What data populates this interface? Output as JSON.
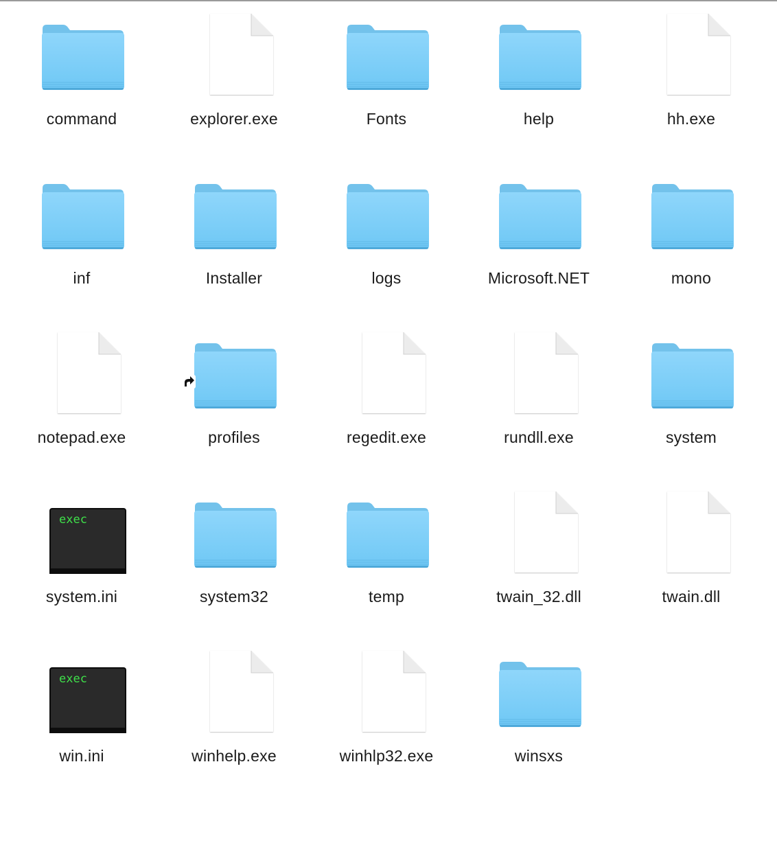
{
  "colors": {
    "folder_light": "#8fd6fb",
    "folder_main": "#6fc8f5",
    "folder_edge": "#5ab7e8",
    "terminal_bg": "#2a2a2a",
    "terminal_text": "#3fe04a",
    "label_text": "#1b1b1b"
  },
  "files": [
    {
      "name": "command",
      "icon": "folder-icon"
    },
    {
      "name": "explorer.exe",
      "icon": "document-icon"
    },
    {
      "name": "Fonts",
      "icon": "folder-icon"
    },
    {
      "name": "help",
      "icon": "folder-icon"
    },
    {
      "name": "hh.exe",
      "icon": "document-icon"
    },
    {
      "name": "inf",
      "icon": "folder-icon"
    },
    {
      "name": "Installer",
      "icon": "folder-icon"
    },
    {
      "name": "logs",
      "icon": "folder-icon"
    },
    {
      "name": "Microsoft.NET",
      "icon": "folder-icon"
    },
    {
      "name": "mono",
      "icon": "folder-icon"
    },
    {
      "name": "notepad.exe",
      "icon": "document-icon"
    },
    {
      "name": "profiles",
      "icon": "folder-icon",
      "alias": true
    },
    {
      "name": "regedit.exe",
      "icon": "document-icon"
    },
    {
      "name": "rundll.exe",
      "icon": "document-icon"
    },
    {
      "name": "system",
      "icon": "folder-icon"
    },
    {
      "name": "system.ini",
      "icon": "terminal-exec-icon",
      "icon_text": "exec"
    },
    {
      "name": "system32",
      "icon": "folder-icon"
    },
    {
      "name": "temp",
      "icon": "folder-icon"
    },
    {
      "name": "twain_32.dll",
      "icon": "document-icon"
    },
    {
      "name": "twain.dll",
      "icon": "document-icon"
    },
    {
      "name": "win.ini",
      "icon": "terminal-exec-icon",
      "icon_text": "exec"
    },
    {
      "name": "winhelp.exe",
      "icon": "document-icon"
    },
    {
      "name": "winhlp32.exe",
      "icon": "document-icon"
    },
    {
      "name": "winsxs",
      "icon": "folder-icon"
    }
  ]
}
